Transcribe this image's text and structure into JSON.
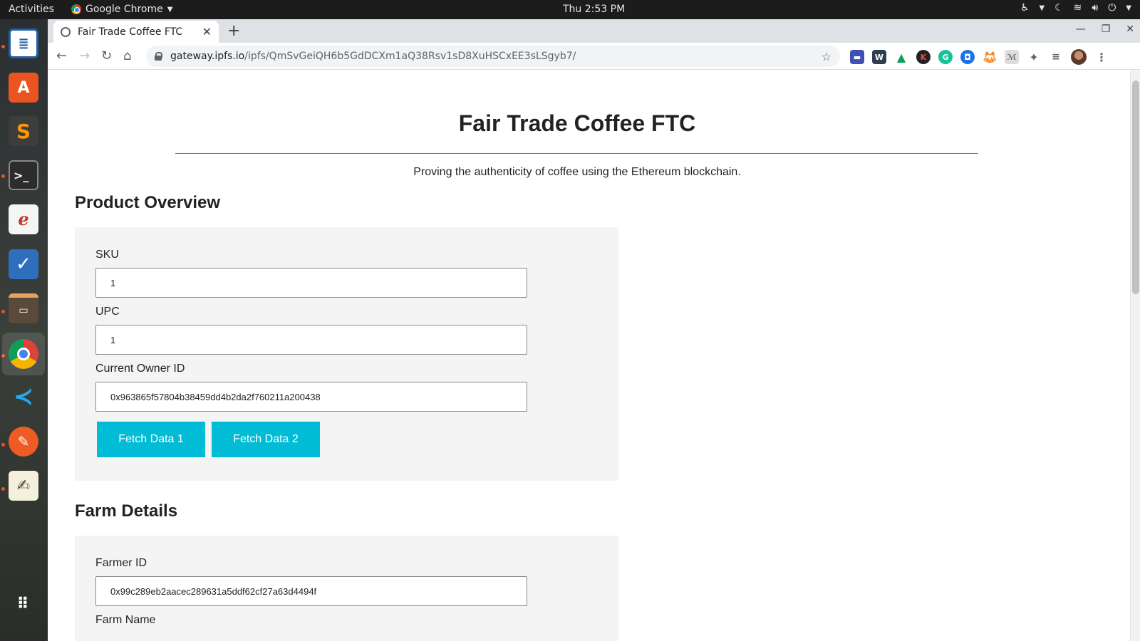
{
  "topbar": {
    "activities": "Activities",
    "app_name": "Google Chrome",
    "clock": "Thu  2:53 PM"
  },
  "dock": {
    "apps": [
      "libreoffice-writer-icon",
      "ubuntu-software-icon",
      "sublime-text-icon",
      "terminal-icon",
      "evince-icon",
      "tasks-icon",
      "files-icon",
      "chrome-icon",
      "vscode-icon",
      "postman-icon",
      "text-editor-icon",
      "show-apps-icon"
    ]
  },
  "browser": {
    "tab_title": "Fair Trade Coffee FTC",
    "url_host": "gateway.ipfs.io",
    "url_path": "/ipfs/QmSvGeiQH6b5GdDCXm1aQ38Rsv1sD8XuHSCxEE3sLSgyb7/"
  },
  "page": {
    "title": "Fair Trade Coffee FTC",
    "subtitle": "Proving the authenticity of coffee using the Ethereum blockchain.",
    "product_overview": {
      "heading": "Product Overview",
      "sku_label": "SKU",
      "sku_value": "1",
      "upc_label": "UPC",
      "upc_value": "1",
      "owner_label": "Current Owner ID",
      "owner_value": "0x963865f57804b38459dd4b2da2f760211a200438",
      "fetch1_label": "Fetch Data 1",
      "fetch2_label": "Fetch Data 2"
    },
    "farm_details": {
      "heading": "Farm Details",
      "farmer_id_label": "Farmer ID",
      "farmer_id_value": "0x99c289eb2aacec289631a5ddf62cf27a63d4494f",
      "farm_name_label": "Farm Name"
    }
  },
  "colors": {
    "accent": "#00bcd4",
    "panel_bg": "#f4f4f4",
    "ubuntu_orange": "#e95420"
  }
}
